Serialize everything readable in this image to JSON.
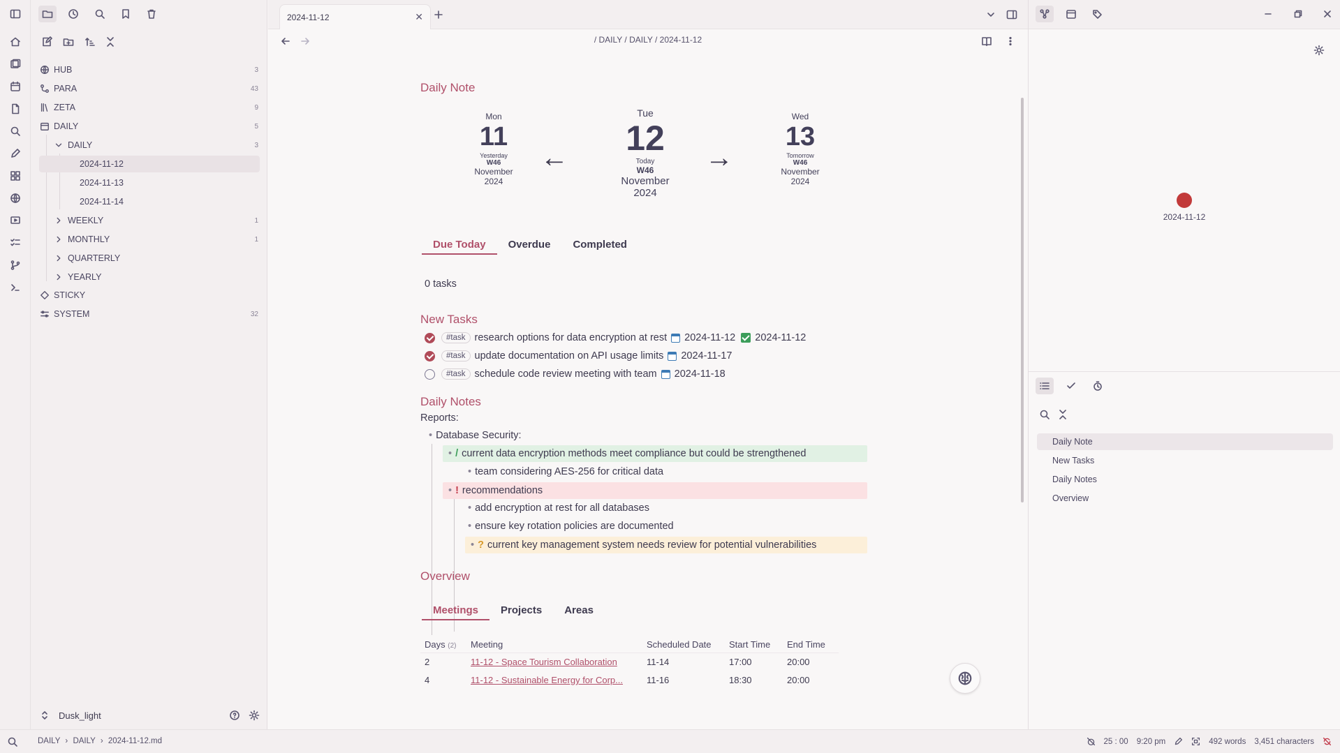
{
  "sidebar": {
    "tree": [
      {
        "label": "HUB",
        "count": "3",
        "icon": "globe-icon"
      },
      {
        "label": "PARA",
        "count": "43",
        "icon": "link-icon"
      },
      {
        "label": "ZETA",
        "count": "9",
        "icon": "library-icon"
      },
      {
        "label": "DAILY",
        "count": "5",
        "icon": "calendar-icon"
      },
      {
        "label": "DAILY",
        "count": "3"
      },
      {
        "label": "2024-11-12"
      },
      {
        "label": "2024-11-13"
      },
      {
        "label": "2024-11-14"
      },
      {
        "label": "WEEKLY",
        "count": "1"
      },
      {
        "label": "MONTHLY",
        "count": "1"
      },
      {
        "label": "QUARTERLY",
        "count": ""
      },
      {
        "label": "YEARLY",
        "count": ""
      },
      {
        "label": "STICKY",
        "count": "",
        "icon": "puzzle-icon"
      },
      {
        "label": "SYSTEM",
        "count": "32",
        "icon": "sliders-icon"
      }
    ],
    "vault_name": "Dusk_light"
  },
  "tab": {
    "title": "2024-11-12"
  },
  "breadcrumb": "/ DAILY / DAILY / 2024-11-12",
  "doc": {
    "daily_note_heading": "Daily Note",
    "prev": {
      "dow": "Mon",
      "num": "11",
      "rel": "Yesterday",
      "week": "W46",
      "month": "November",
      "year": "2024"
    },
    "today": {
      "dow": "Tue",
      "num": "12",
      "rel": "Today",
      "week": "W46",
      "month": "November",
      "year": "2024"
    },
    "next": {
      "dow": "Wed",
      "num": "13",
      "rel": "Tomorrow",
      "week": "W46",
      "month": "November",
      "year": "2024"
    },
    "task_tabs": [
      "Due Today",
      "Overdue",
      "Completed"
    ],
    "task_count": "0 tasks",
    "new_tasks_heading": "New Tasks",
    "tasks": [
      {
        "tag": "#task",
        "text": "research options for data encryption at rest",
        "due": "2024-11-12",
        "done_date": "2024-11-12",
        "done": true
      },
      {
        "tag": "#task",
        "text": "update documentation on API usage limits",
        "due": "2024-11-17",
        "done": true
      },
      {
        "tag": "#task",
        "text": "schedule code review meeting with team",
        "due": "2024-11-18",
        "done": false
      }
    ],
    "daily_notes_heading": "Daily Notes",
    "reports_label": "Reports:",
    "db_security": "Database Security:",
    "note_green_mark": "/",
    "note_green": "current data encryption methods meet compliance but could be strengthened",
    "note_sub1": "team considering AES-256 for critical data",
    "note_red_mark": "!",
    "note_red": "recommendations",
    "note_sub2": "add encryption at rest for all databases",
    "note_sub3": "ensure key rotation policies are documented",
    "note_yellow_mark": "?",
    "note_yellow": "current key management system needs review for potential vulnerabilities",
    "overview_heading": "Overview",
    "overview_tabs": [
      "Meetings",
      "Projects",
      "Areas"
    ],
    "table": {
      "headers": [
        "Days",
        "Meeting",
        "Scheduled Date",
        "Start Time",
        "End Time"
      ],
      "days_count": "(2)",
      "rows": [
        [
          "2",
          "11-12 - Space Tourism Collaboration",
          "11-14",
          "17:00",
          "20:00"
        ],
        [
          "4",
          "11-12 - Sustainable Energy for Corp...",
          "11-16",
          "18:30",
          "20:00"
        ]
      ]
    }
  },
  "right": {
    "graph_node_label": "2024-11-12",
    "outline": [
      "Daily Note",
      "New Tasks",
      "Daily Notes",
      "Overview"
    ]
  },
  "status": {
    "path": [
      "DAILY",
      "DAILY",
      "2024-11-12.md"
    ],
    "timer": "25 : 00",
    "time": "9:20 pm",
    "words": "492 words",
    "chars": "3,451 characters"
  },
  "colors": {
    "accent": "#b0506a",
    "node": "#c23a3a"
  }
}
